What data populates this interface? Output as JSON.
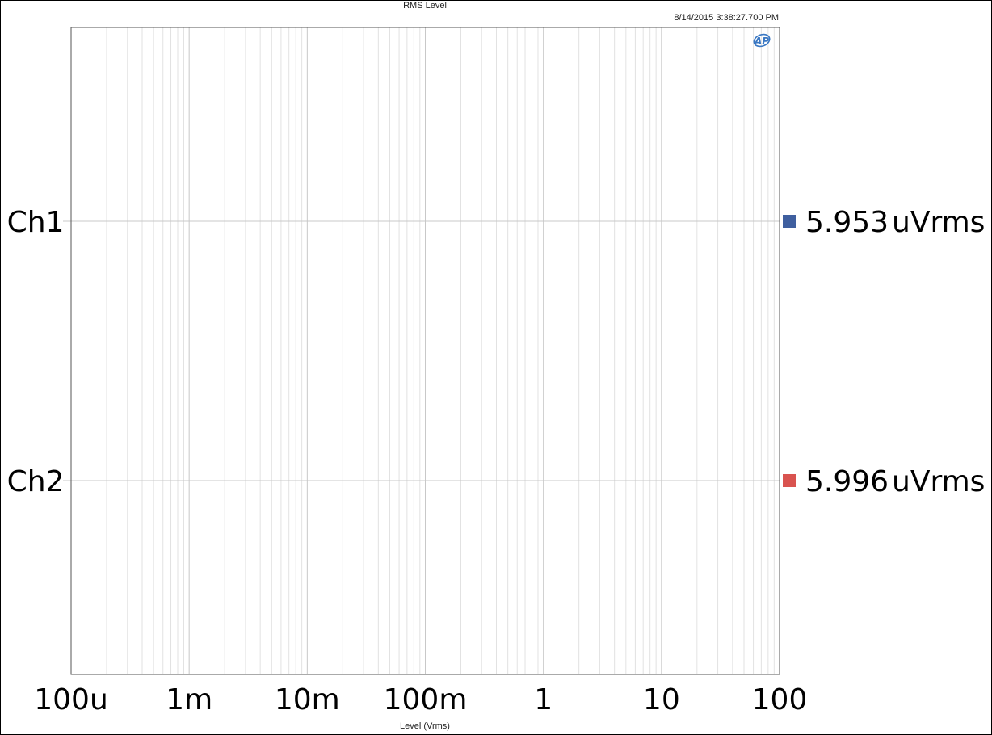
{
  "chart_data": {
    "type": "bar",
    "title": "RMS Level",
    "timestamp": "8/14/2015 3:38:27.700 PM",
    "xlabel": "Level (Vrms)",
    "x_scale": "log",
    "xlim": [
      0.0001,
      100
    ],
    "x_ticks": [
      {
        "value": 0.0001,
        "label": "100u"
      },
      {
        "value": 0.001,
        "label": "1m"
      },
      {
        "value": 0.01,
        "label": "10m"
      },
      {
        "value": 0.1,
        "label": "100m"
      },
      {
        "value": 1,
        "label": "1"
      },
      {
        "value": 10,
        "label": "10"
      },
      {
        "value": 100,
        "label": "100"
      }
    ],
    "categories": [
      "Ch1",
      "Ch2"
    ],
    "series": [
      {
        "name": "Ch1",
        "value": 5.953e-06,
        "readout": "5.953",
        "unit": "uVrms",
        "color": "#3f5f9f"
      },
      {
        "name": "Ch2",
        "value": 5.996e-06,
        "readout": "5.996",
        "unit": "uVrms",
        "color": "#d9534f"
      }
    ],
    "grid": true,
    "logo": "AP"
  }
}
